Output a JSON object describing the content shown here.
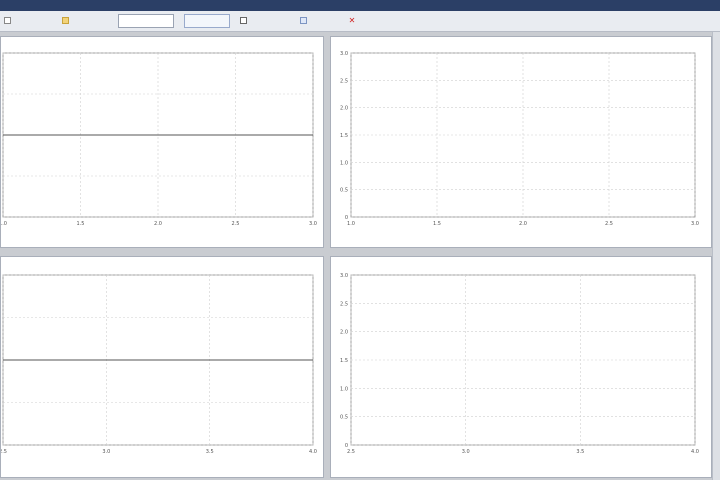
{
  "window": {
    "title": ""
  },
  "toolbar": {
    "items": [
      {
        "label": "",
        "icon": "chart-icon"
      },
      {
        "label": "",
        "icon": "folder-icon"
      }
    ],
    "datetime": "",
    "button_label": "",
    "toggles": [
      {
        "label": "",
        "checked": false
      },
      {
        "label": "",
        "checked": true
      },
      {
        "label": "",
        "icon": "close-icon"
      }
    ]
  },
  "colors": {
    "signal": "#cc2222",
    "envelope": "#3333cc",
    "grid": "#cfcfcf",
    "axis": "#888888"
  },
  "panels": [
    {
      "title": "",
      "title_color": "normal",
      "xlabel": "",
      "chart_data": {
        "type": "line",
        "x_ticks": [
          "1.0",
          "1.5",
          "2.0",
          "2.5",
          "3.0"
        ],
        "y_ticks": [],
        "ylim": [
          -1,
          1
        ],
        "series": [
          {
            "values": []
          }
        ]
      }
    },
    {
      "title": "",
      "title_color": "normal",
      "xlabel": "",
      "chart_data": {
        "type": "line",
        "x_ticks": [
          "1.0",
          "1.5",
          "2.0",
          "2.5",
          "3.0"
        ],
        "y_ticks": [
          "0",
          "0.5",
          "1.0",
          "1.5",
          "2.0",
          "2.5",
          "3.0"
        ],
        "ylim": [
          0,
          3
        ],
        "series": [
          {
            "values": []
          }
        ]
      }
    },
    {
      "title": "",
      "title_color": "red",
      "xlabel": "",
      "chart_data": {
        "type": "line",
        "x_ticks": [
          "2.5",
          "3.0",
          "3.5",
          "4.0"
        ],
        "y_ticks": [],
        "ylim": [
          -1,
          1
        ],
        "series": [
          {
            "values": []
          }
        ]
      }
    },
    {
      "title": "",
      "title_color": "normal",
      "xlabel": "",
      "chart_data": {
        "type": "line",
        "x_ticks": [
          "2.5",
          "3.0",
          "3.5",
          "4.0"
        ],
        "y_ticks": [
          "0",
          "0.5",
          "1.0",
          "1.5",
          "2.0",
          "2.5",
          "3.0"
        ],
        "ylim": [
          0,
          3
        ],
        "series": [
          {
            "values": []
          }
        ]
      }
    }
  ]
}
